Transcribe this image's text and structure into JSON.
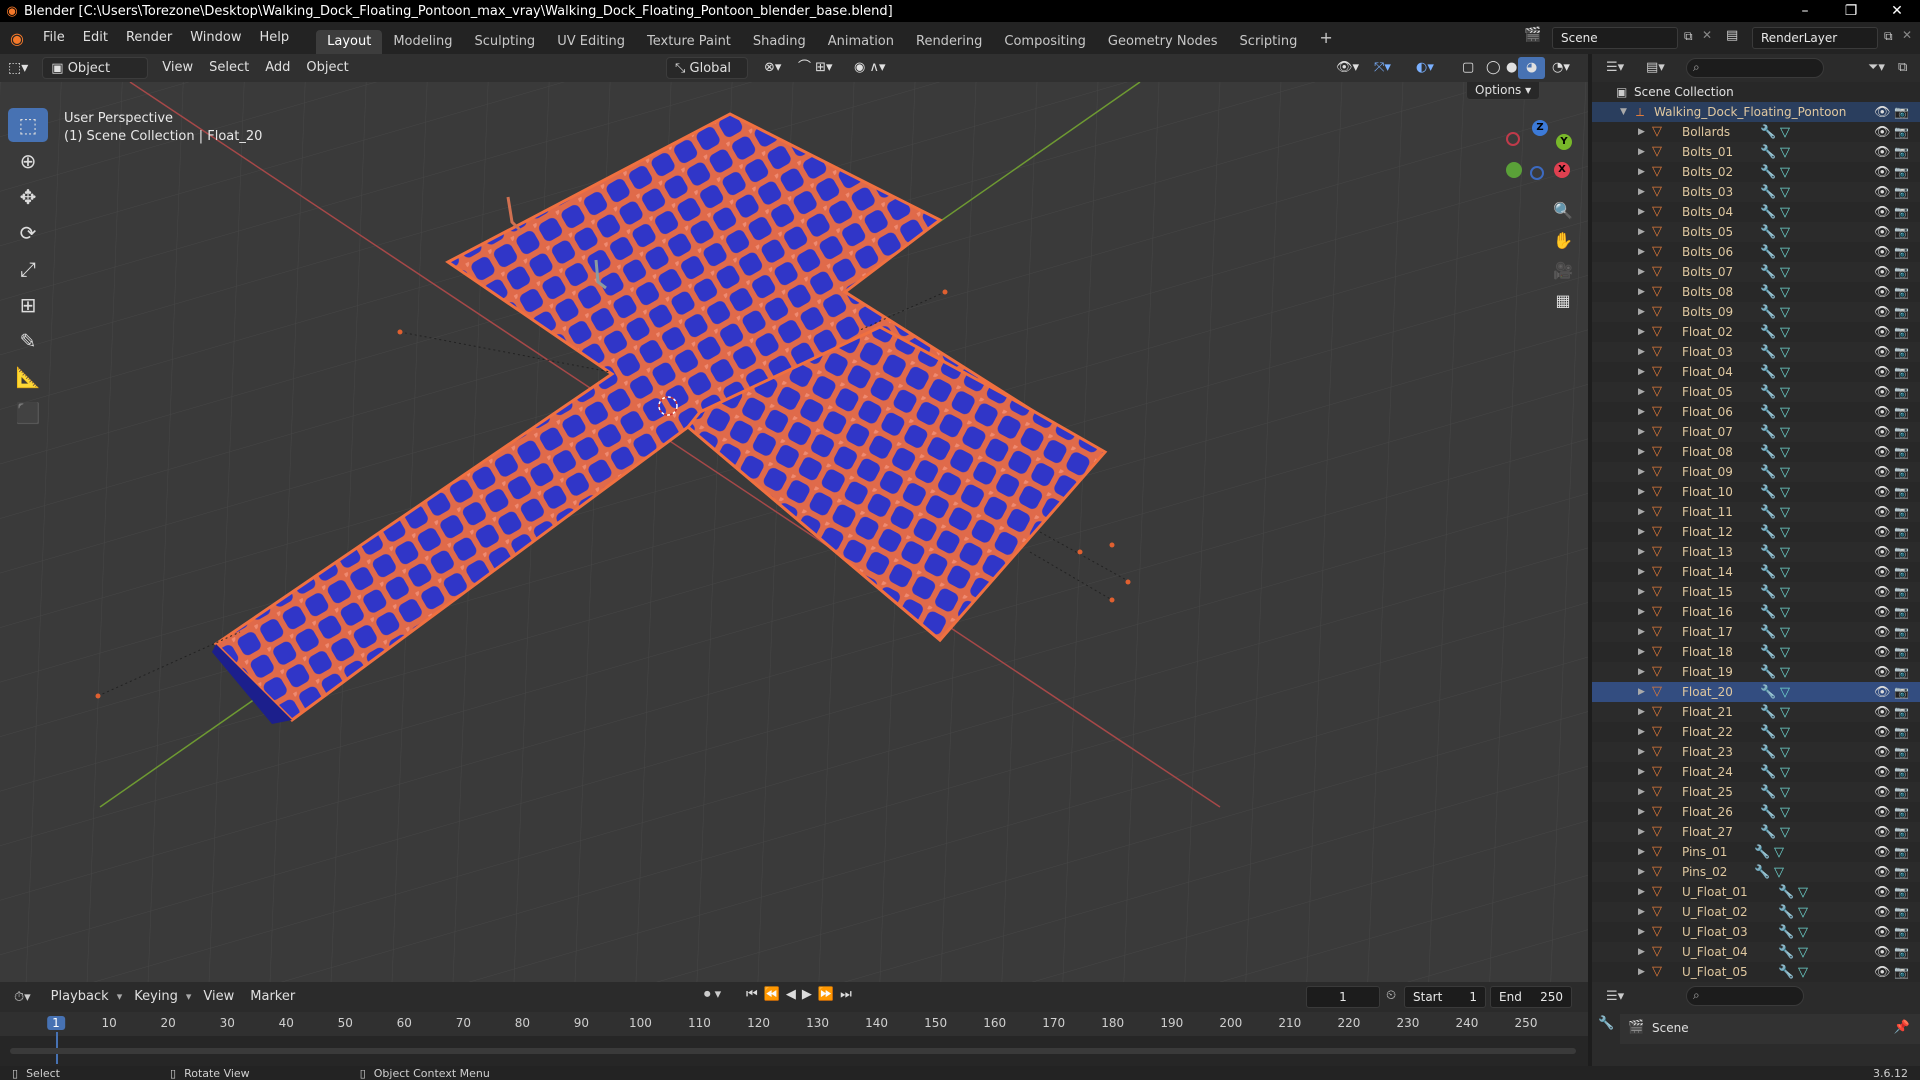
{
  "window": {
    "title": "Blender [C:\\Users\\Torezone\\Desktop\\Walking_Dock_Floating_Pontoon_max_vray\\Walking_Dock_Floating_Pontoon_blender_base.blend]",
    "minimize": "–",
    "maximize": "❐",
    "close": "✕"
  },
  "menu": [
    "File",
    "Edit",
    "Render",
    "Window",
    "Help"
  ],
  "workspaces": [
    "Layout",
    "Modeling",
    "Sculpting",
    "UV Editing",
    "Texture Paint",
    "Shading",
    "Animation",
    "Rendering",
    "Compositing",
    "Geometry Nodes",
    "Scripting"
  ],
  "workspace_add": "+",
  "active_workspace": "Layout",
  "scene_name": "Scene",
  "render_layer": "RenderLayer",
  "viewport_header": {
    "mode": "Object Mode",
    "menus": [
      "View",
      "Select",
      "Add",
      "Object"
    ],
    "transform_orientation": "Global",
    "options": "Options"
  },
  "viewport": {
    "perspective": "User Perspective",
    "collection_info": "(1) Scene Collection | Float_20",
    "gizmo_axes": [
      "Z",
      "Y",
      "X"
    ]
  },
  "outliner": {
    "root": "Scene Collection",
    "collection": "Walking_Dock_Floating_Pontoon",
    "items": [
      "Bollards",
      "Bolts_01",
      "Bolts_02",
      "Bolts_03",
      "Bolts_04",
      "Bolts_05",
      "Bolts_06",
      "Bolts_07",
      "Bolts_08",
      "Bolts_09",
      "Float_02",
      "Float_03",
      "Float_04",
      "Float_05",
      "Float_06",
      "Float_07",
      "Float_08",
      "Float_09",
      "Float_10",
      "Float_11",
      "Float_12",
      "Float_13",
      "Float_14",
      "Float_15",
      "Float_16",
      "Float_17",
      "Float_18",
      "Float_19",
      "Float_20",
      "Float_21",
      "Float_22",
      "Float_23",
      "Float_24",
      "Float_25",
      "Float_26",
      "Float_27",
      "Pins_01",
      "Pins_02",
      "U_Float_01",
      "U_Float_02",
      "U_Float_03",
      "U_Float_04",
      "U_Float_05"
    ],
    "selected": "Float_20"
  },
  "timeline": {
    "menus": [
      "Playback",
      "Keying",
      "View",
      "Marker"
    ],
    "current_frame": "1",
    "start_label": "Start",
    "start": "1",
    "end_label": "End",
    "end": "250",
    "ruler_labels": [
      "1",
      "10",
      "20",
      "30",
      "40",
      "50",
      "60",
      "70",
      "80",
      "90",
      "100",
      "110",
      "120",
      "130",
      "140",
      "150",
      "160",
      "170",
      "180",
      "190",
      "200",
      "210",
      "220",
      "230",
      "240",
      "250"
    ]
  },
  "properties": {
    "scene_label": "Scene"
  },
  "statusbar": {
    "select": "Select",
    "rotate": "Rotate View",
    "context": "Object Context Menu",
    "version": "3.6.12"
  },
  "colors": {
    "accent": "#4772b3",
    "selection_outline": "#f0703a",
    "float_fill": "#2e33c8",
    "axis_x": "#c84a4a",
    "axis_y": "#7ab83a"
  }
}
